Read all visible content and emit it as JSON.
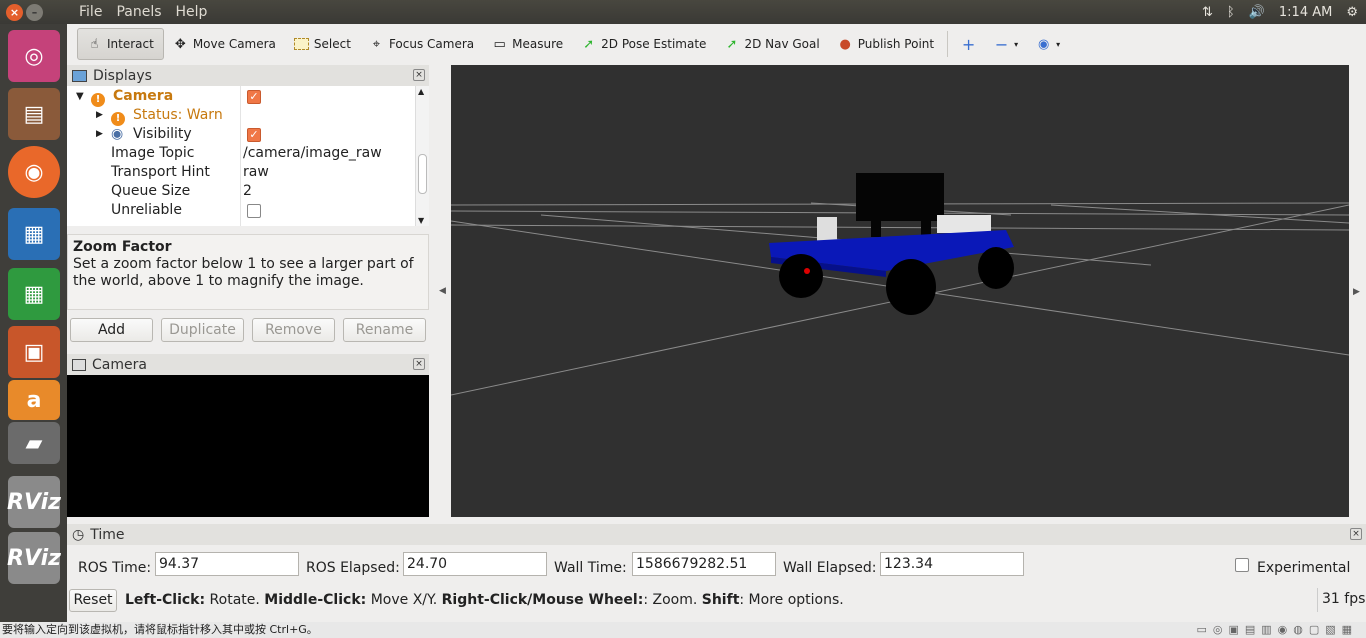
{
  "menubar": {
    "items": [
      "File",
      "Panels",
      "Help"
    ]
  },
  "tray": {
    "time": "1:14 AM"
  },
  "launcher": {
    "items": [
      "ubuntu-icon",
      "files-icon",
      "firefox-icon",
      "writer-icon",
      "calc-icon",
      "impress-icon",
      "amazon-icon",
      "software-icon",
      "rviz-icon",
      "rviz-icon"
    ],
    "rviz_label": "RViz"
  },
  "toolbar": {
    "interact": "Interact",
    "move_camera": "Move Camera",
    "select": "Select",
    "focus_camera": "Focus Camera",
    "measure": "Measure",
    "pose_estimate": "2D Pose Estimate",
    "nav_goal": "2D Nav Goal",
    "publish_point": "Publish Point"
  },
  "displays": {
    "title": "Displays",
    "camera": "Camera",
    "status": "Status: Warn",
    "visibility": "Visibility",
    "props": [
      {
        "label": "Image Topic",
        "value": "/camera/image_raw"
      },
      {
        "label": "Transport Hint",
        "value": "raw"
      },
      {
        "label": "Queue Size",
        "value": "2"
      },
      {
        "label": "Unreliable",
        "value": ""
      }
    ]
  },
  "description": {
    "title": "Zoom Factor",
    "body": "Set a zoom factor below 1 to see a larger part of the world, above 1 to magnify the image."
  },
  "buttons": {
    "add": "Add",
    "duplicate": "Duplicate",
    "remove": "Remove",
    "rename": "Rename"
  },
  "camera_panel": {
    "title": "Camera"
  },
  "time_panel": {
    "title": "Time",
    "ros_time_label": "ROS Time:",
    "ros_time": "94.37",
    "ros_elapsed_label": "ROS Elapsed:",
    "ros_elapsed": "24.70",
    "wall_time_label": "Wall Time:",
    "wall_time": "1586679282.51",
    "wall_elapsed_label": "Wall Elapsed:",
    "wall_elapsed": "123.34",
    "experimental": "Experimental"
  },
  "statusbar": {
    "reset": "Reset",
    "lc_b": "Left-Click:",
    "lc": " Rotate. ",
    "mc_b": "Middle-Click:",
    "mc": " Move X/Y. ",
    "rc_b": "Right-Click/Mouse Wheel:",
    "rc": ": Zoom. ",
    "sh_b": "Shift",
    "sh": ": More options.",
    "fps": "31 fps"
  },
  "vm_hint": "要将输入定向到该虚拟机，请将鼠标指针移入其中或按 Ctrl+G。",
  "colors": {
    "accent": "#f07746",
    "warn": "#c7790f",
    "robot_body": "#0a18b8"
  }
}
